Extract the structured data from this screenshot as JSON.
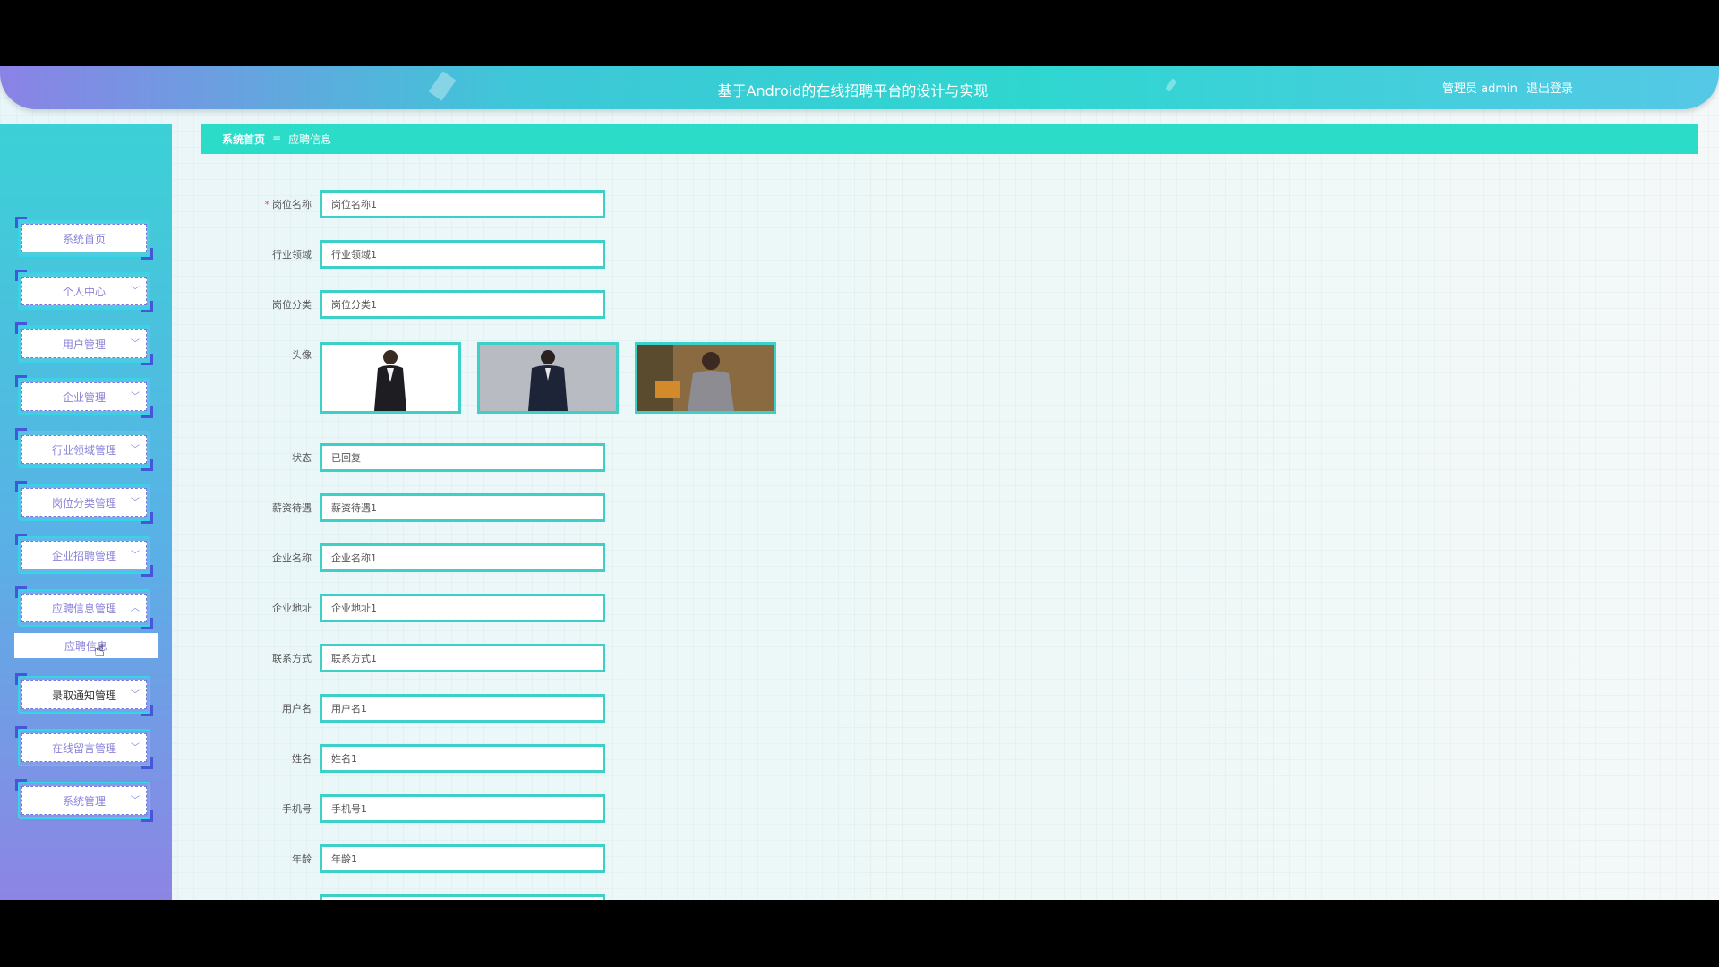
{
  "header": {
    "title": "基于Android的在线招聘平台的设计与实现",
    "role": "管理员 admin",
    "logout": "退出登录"
  },
  "sidebar": {
    "items": [
      {
        "label": "系统首页",
        "chevron": ""
      },
      {
        "label": "个人中心",
        "chevron": "﹀"
      },
      {
        "label": "用户管理",
        "chevron": "﹀"
      },
      {
        "label": "企业管理",
        "chevron": "﹀"
      },
      {
        "label": "行业领域管理",
        "chevron": "﹀"
      },
      {
        "label": "岗位分类管理",
        "chevron": "﹀"
      },
      {
        "label": "企业招聘管理",
        "chevron": "﹀"
      },
      {
        "label": "应聘信息管理",
        "chevron": "︿"
      },
      {
        "label": "录取通知管理",
        "chevron": "﹀"
      },
      {
        "label": "在线留言管理",
        "chevron": "﹀"
      },
      {
        "label": "系统管理",
        "chevron": "﹀"
      }
    ],
    "submenu": "应聘信息"
  },
  "breadcrumb": {
    "home": "系统首页",
    "sep": "≡",
    "current": "应聘信息"
  },
  "form": {
    "fields": [
      {
        "label": "岗位名称",
        "value": "岗位名称1",
        "required": "*"
      },
      {
        "label": "行业领域",
        "value": "行业领域1"
      },
      {
        "label": "岗位分类",
        "value": "岗位分类1"
      },
      {
        "label": "头像"
      },
      {
        "label": "状态",
        "value": "已回复"
      },
      {
        "label": "薪资待遇",
        "value": "薪资待遇1"
      },
      {
        "label": "企业名称",
        "value": "企业名称1"
      },
      {
        "label": "企业地址",
        "value": "企业地址1"
      },
      {
        "label": "联系方式",
        "value": "联系方式1"
      },
      {
        "label": "用户名",
        "value": "用户名1"
      },
      {
        "label": "姓名",
        "value": "姓名1"
      },
      {
        "label": "手机号",
        "value": "手机号1"
      },
      {
        "label": "年龄",
        "value": "年龄1"
      }
    ]
  },
  "colors": {
    "accent": "#2bdcc9",
    "input_border": "#3cd0c8",
    "menu_text": "#8a83d8"
  }
}
